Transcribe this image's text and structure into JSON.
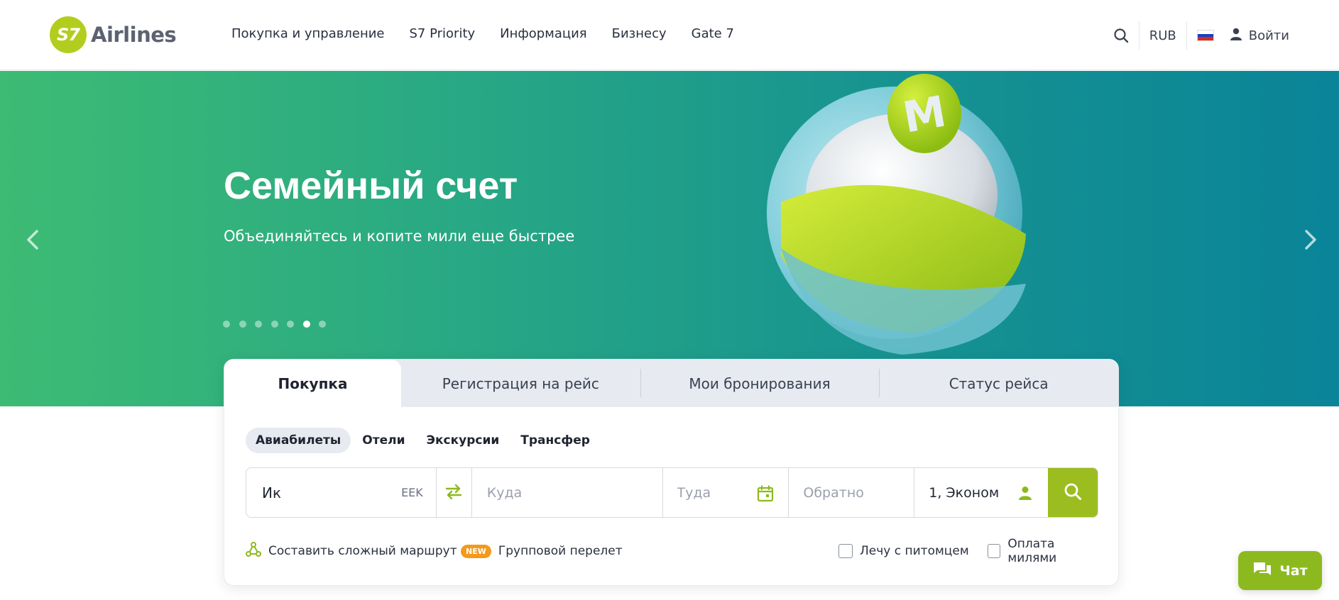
{
  "header": {
    "logo_mark": "S7",
    "logo_text": "Airlines",
    "nav": [
      "Покупка и управление",
      "S7 Priority",
      "Информация",
      "Бизнесу",
      "Gate 7"
    ],
    "currency": "RUB",
    "login_label": "Войти"
  },
  "hero": {
    "title": "Семейный счет",
    "subtitle": "Объединяйтесь и копите мили еще быстрее",
    "active_dot_index": 5,
    "dot_count": 7
  },
  "booking": {
    "tabs": [
      "Покупка",
      "Регистрация на рейс",
      "Мои бронирования",
      "Статус рейса"
    ],
    "subtabs": [
      "Авиабилеты",
      "Отели",
      "Экскурсии",
      "Трансфер"
    ],
    "from": {
      "value": "Ик",
      "code": "EEK"
    },
    "to": {
      "placeholder": "Куда"
    },
    "date_there": {
      "placeholder": "Туда"
    },
    "date_back": {
      "placeholder": "Обратно"
    },
    "passengers": "1, Эконом",
    "complex_route": "Составить сложный маршрут",
    "new_badge": "NEW",
    "group_flight": "Групповой перелет",
    "pet_option": "Лечу с питомцем",
    "miles_option": "Оплата милями"
  },
  "chat": {
    "label": "Чат"
  },
  "colors": {
    "brand_green": "#b3cd1e",
    "search_button": "#9cbd1f",
    "new_badge": "#f39a1a",
    "hero_gradient_start": "#3dbb74",
    "hero_gradient_end": "#0a8498"
  }
}
